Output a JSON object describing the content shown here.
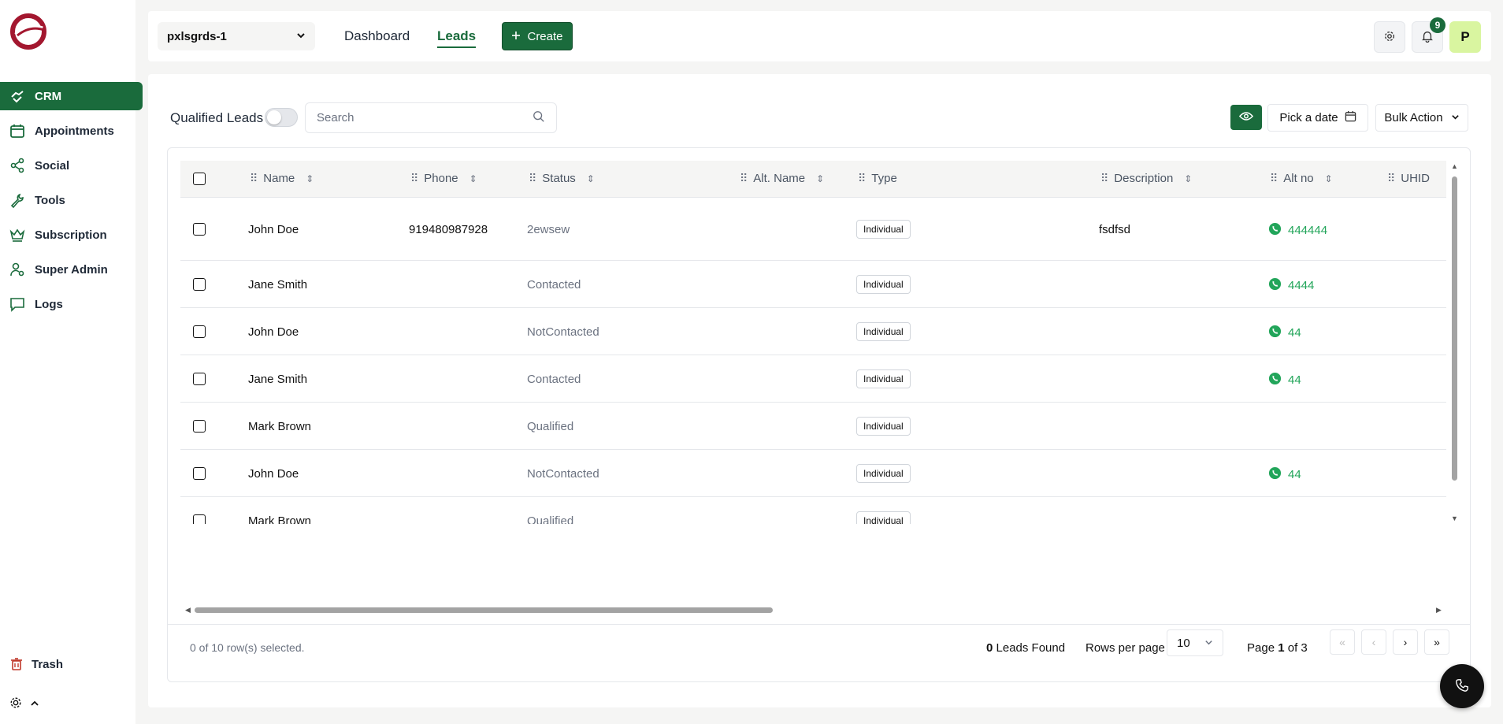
{
  "sidebar": {
    "items": [
      {
        "label": "CRM",
        "icon": "handshake-icon"
      },
      {
        "label": "Appointments",
        "icon": "calendar-icon"
      },
      {
        "label": "Social",
        "icon": "share-icon"
      },
      {
        "label": "Tools",
        "icon": "wrench-icon"
      },
      {
        "label": "Subscription",
        "icon": "crown-icon"
      },
      {
        "label": "Super Admin",
        "icon": "user-gear-icon"
      },
      {
        "label": "Logs",
        "icon": "chat-icon"
      }
    ],
    "trash_label": "Trash"
  },
  "header": {
    "workspace": "pxlsgrds-1",
    "tabs": [
      {
        "label": "Dashboard"
      },
      {
        "label": "Leads"
      }
    ],
    "create_label": "Create",
    "notification_count": "9",
    "avatar_initial": "P"
  },
  "toolbar": {
    "qualified_label": "Qualified Leads",
    "search_placeholder": "Search",
    "date_label": "Pick a date",
    "bulk_label": "Bulk Action"
  },
  "table": {
    "columns": [
      "Name",
      "Phone",
      "Status",
      "Alt. Name",
      "Type",
      "Description",
      "Alt no",
      "UHID"
    ],
    "rows": [
      {
        "name": "John Doe",
        "phone": "919480987928",
        "status": "2ewsew",
        "type": "Individual",
        "description": "fsdfsd",
        "alt_no": "444444"
      },
      {
        "name": "Jane Smith",
        "phone": "",
        "status": "Contacted",
        "type": "Individual",
        "description": "",
        "alt_no": "4444"
      },
      {
        "name": "John Doe",
        "phone": "",
        "status": "NotContacted",
        "type": "Individual",
        "description": "",
        "alt_no": "44"
      },
      {
        "name": "Jane Smith",
        "phone": "",
        "status": "Contacted",
        "type": "Individual",
        "description": "",
        "alt_no": "44"
      },
      {
        "name": "Mark Brown",
        "phone": "",
        "status": "Qualified",
        "type": "Individual",
        "description": "",
        "alt_no": ""
      },
      {
        "name": "John Doe",
        "phone": "",
        "status": "NotContacted",
        "type": "Individual",
        "description": "",
        "alt_no": "44"
      },
      {
        "name": "Mark Brown",
        "phone": "",
        "status": "Qualified",
        "type": "Individual",
        "description": "",
        "alt_no": ""
      }
    ]
  },
  "footer": {
    "selected_text": "0 of 10 row(s) selected.",
    "found_count": "0",
    "found_label": "Leads Found",
    "rows_per_page_label": "Rows per page",
    "rows_per_page_value": "10",
    "page_prefix": "Page",
    "page_current": "1",
    "page_suffix": "of 3"
  },
  "colors": {
    "brand_green": "#1a6b3c",
    "whatsapp_green": "#22a55a",
    "logo_red": "#a3172f"
  }
}
